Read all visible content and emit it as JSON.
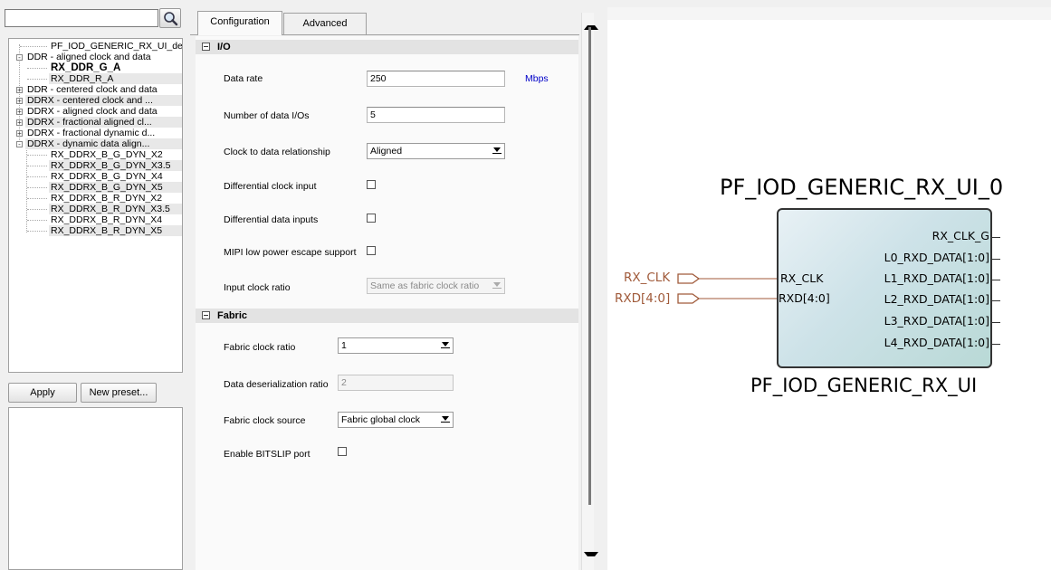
{
  "left_panel": {
    "search": {
      "value": "",
      "icon": "magnifier-icon"
    },
    "tree": [
      {
        "label": "PF_IOD_GENERIC_RX_UI_def...",
        "level": 1,
        "expander": "",
        "hl": false,
        "bold": false
      },
      {
        "label": "DDR - aligned clock and data",
        "level": 0,
        "expander": "-",
        "hl": false,
        "bold": false
      },
      {
        "label": "RX_DDR_G_A",
        "level": 1,
        "expander": "",
        "hl": false,
        "bold": true
      },
      {
        "label": "RX_DDR_R_A",
        "level": 1,
        "expander": "",
        "hl": true,
        "bold": false
      },
      {
        "label": "DDR - centered clock and data",
        "level": 0,
        "expander": "+",
        "hl": false,
        "bold": false
      },
      {
        "label": "DDRX - centered clock and ...",
        "level": 0,
        "expander": "+",
        "hl": true,
        "bold": false
      },
      {
        "label": "DDRX - aligned clock and data",
        "level": 0,
        "expander": "+",
        "hl": false,
        "bold": false
      },
      {
        "label": "DDRX - fractional aligned cl...",
        "level": 0,
        "expander": "+",
        "hl": true,
        "bold": false
      },
      {
        "label": "DDRX - fractional dynamic d...",
        "level": 0,
        "expander": "+",
        "hl": false,
        "bold": false
      },
      {
        "label": "DDRX - dynamic data align...",
        "level": 0,
        "expander": "-",
        "hl": true,
        "bold": false
      },
      {
        "label": "RX_DDRX_B_G_DYN_X2",
        "level": 1,
        "expander": "",
        "hl": false,
        "bold": false
      },
      {
        "label": "RX_DDRX_B_G_DYN_X3.5",
        "level": 1,
        "expander": "",
        "hl": true,
        "bold": false
      },
      {
        "label": "RX_DDRX_B_G_DYN_X4",
        "level": 1,
        "expander": "",
        "hl": false,
        "bold": false
      },
      {
        "label": "RX_DDRX_B_G_DYN_X5",
        "level": 1,
        "expander": "",
        "hl": true,
        "bold": false
      },
      {
        "label": "RX_DDRX_B_R_DYN_X2",
        "level": 1,
        "expander": "",
        "hl": false,
        "bold": false
      },
      {
        "label": "RX_DDRX_B_R_DYN_X3.5",
        "level": 1,
        "expander": "",
        "hl": true,
        "bold": false
      },
      {
        "label": "RX_DDRX_B_R_DYN_X4",
        "level": 1,
        "expander": "",
        "hl": false,
        "bold": false
      },
      {
        "label": "RX_DDRX_B_R_DYN_X5",
        "level": 1,
        "expander": "",
        "hl": true,
        "bold": false
      }
    ],
    "apply_label": "Apply",
    "new_preset_label": "New preset..."
  },
  "tabs": [
    {
      "label": "Configuration",
      "active": true
    },
    {
      "label": "Advanced",
      "active": false
    }
  ],
  "sections": {
    "io": {
      "title": "I/O",
      "data_rate": {
        "label": "Data rate",
        "value": "250",
        "units": "Mbps"
      },
      "num_data_ios": {
        "label": "Number of data I/Os",
        "value": "5"
      },
      "clock_to_data": {
        "label": "Clock to data relationship",
        "value": "Aligned"
      },
      "diff_clock": {
        "label": "Differential clock input",
        "checked": false
      },
      "diff_data": {
        "label": "Differential data inputs",
        "checked": false
      },
      "mipi": {
        "label": "MIPI low power escape support",
        "checked": false
      },
      "input_clock_ratio": {
        "label": "Input clock ratio",
        "value": "Same as fabric clock ratio",
        "disabled": true
      }
    },
    "fabric": {
      "title": "Fabric",
      "fabric_clock_ratio": {
        "label": "Fabric clock ratio",
        "value": "1"
      },
      "deser_ratio": {
        "label": "Data deserialization ratio",
        "value": "2",
        "disabled": true
      },
      "fabric_clock_source": {
        "label": "Fabric clock source",
        "value": "Fabric global clock"
      },
      "bitslip": {
        "label": "Enable BITSLIP port",
        "checked": false
      }
    }
  },
  "canvas": {
    "instance_name": "PF_IOD_GENERIC_RX_UI_0",
    "component_name": "PF_IOD_GENERIC_RX_UI",
    "inputs": [
      {
        "net": "RX_CLK",
        "pin": "RX_CLK"
      },
      {
        "net": "RXD[4:0]",
        "pin": "RXD[4:0]"
      }
    ],
    "outputs": [
      "RX_CLK_G",
      "L0_RXD_DATA[1:0]",
      "L1_RXD_DATA[1:0]",
      "L2_RXD_DATA[1:0]",
      "L3_RXD_DATA[1:0]",
      "L4_RXD_DATA[1:0]"
    ],
    "colors": {
      "input_net": "#a05a3a",
      "block_fill": "#cde2e8"
    }
  }
}
